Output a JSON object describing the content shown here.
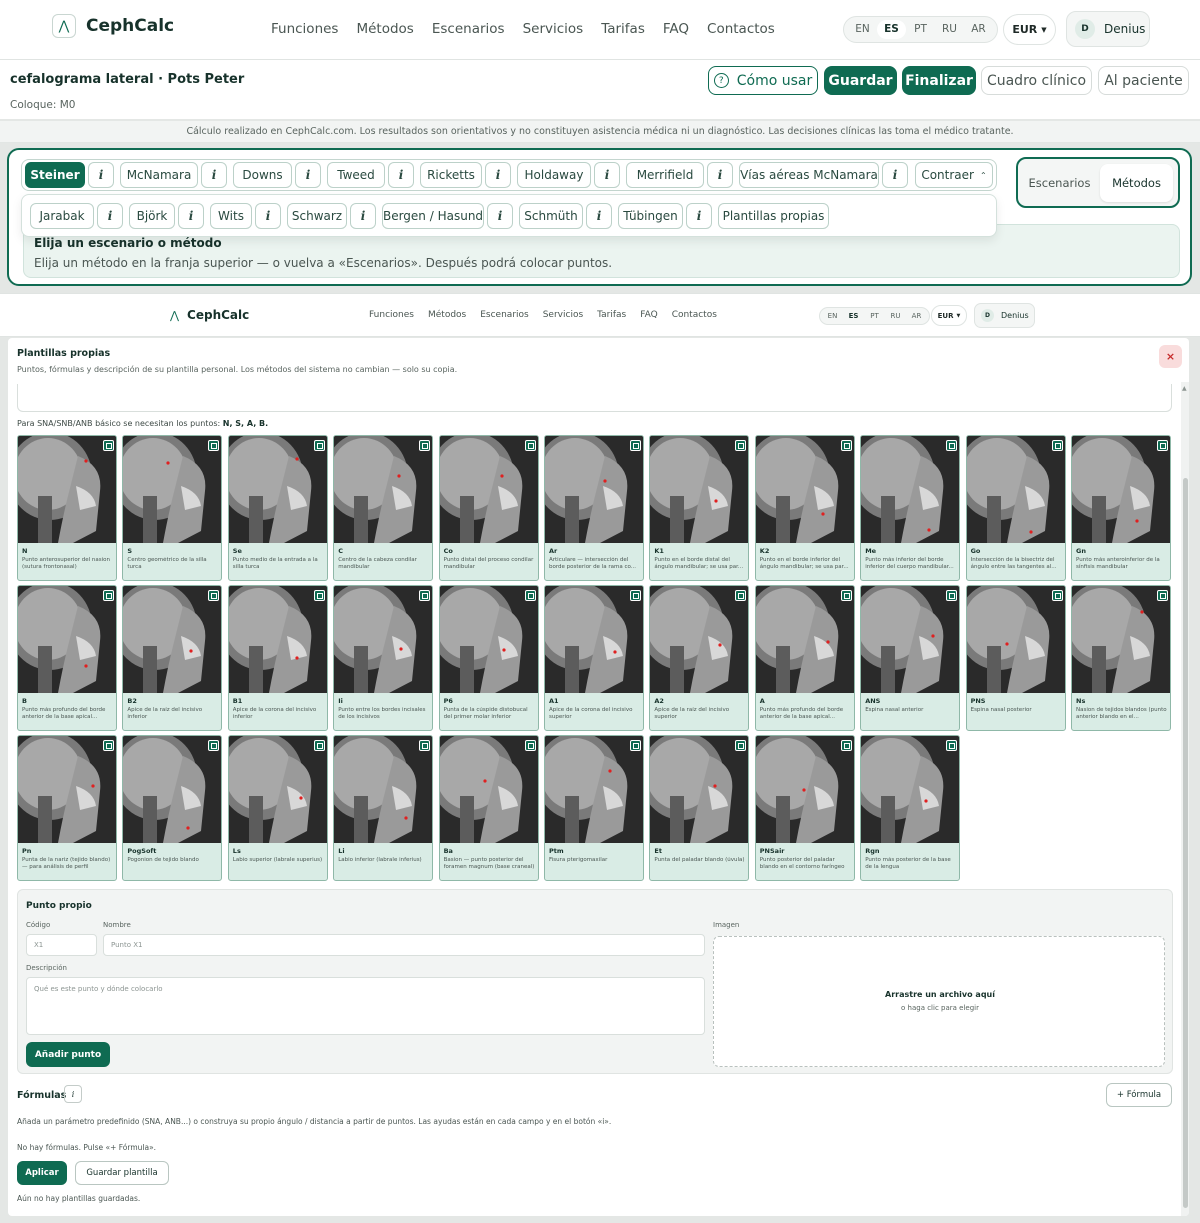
{
  "header": {
    "logo": "CephCalc",
    "nav": [
      "Funciones",
      "Métodos",
      "Escenarios",
      "Servicios",
      "Tarifas",
      "FAQ",
      "Contactos"
    ],
    "langs": [
      "EN",
      "ES",
      "PT",
      "RU",
      "AR"
    ],
    "active_lang": "ES",
    "currency": "EUR",
    "user_initial": "D",
    "user_name": "Denius"
  },
  "patient": {
    "title": "cefalograma lateral · Pots Peter",
    "sub": "Coloque: M0"
  },
  "actions": {
    "how": "Cómo usar",
    "save": "Guardar",
    "finish": "Finalizar",
    "clinical": "Cuadro clínico",
    "patient": "Al paciente"
  },
  "disclaimer": "Cálculo realizado en CephCalc.com. Los resultados son orientativos y no constituyen asistencia médica ni un diagnóstico. Las decisiones clínicas las toma el médico tratante.",
  "methods": {
    "row1": [
      "Steiner",
      "McNamara",
      "Downs",
      "Tweed",
      "Ricketts",
      "Holdaway",
      "Merrifield",
      "Vías aéreas McNamara"
    ],
    "row2": [
      "Jarabak",
      "Björk",
      "Wits",
      "Schwarz",
      "Bergen / Hasund",
      "Schmüth",
      "Tübingen"
    ],
    "own": "Plantillas propias",
    "collapse": "Contraer",
    "info": "i"
  },
  "hint": {
    "title": "Elija un escenario o método",
    "desc": "Elija un método en la franja superior — o vuelva a «Escenarios». Después podrá colocar puntos."
  },
  "switch": {
    "scenarios": "Escenarios",
    "methods": "Métodos"
  },
  "modal": {
    "title": "Plantillas propias",
    "sub": "Puntos, fórmulas y descripción de su plantilla personal. Los métodos del sistema no cambian — solo su copia.",
    "close": "×",
    "req_text": "Para SNA/SNB/ANB básico se necesitan los puntos:",
    "req_points": "N, S, A, B.",
    "points": [
      {
        "code": "N",
        "desc": "Punto anterosuperior del nasion (sutura frontonasal)"
      },
      {
        "code": "S",
        "desc": "Centro geométrico de la silla turca"
      },
      {
        "code": "Se",
        "desc": "Punto medio de la entrada a la silla turca"
      },
      {
        "code": "C",
        "desc": "Centro de la cabeza condilar mandibular"
      },
      {
        "code": "Co",
        "desc": "Punto distal del proceso condilar mandibular"
      },
      {
        "code": "Ar",
        "desc": "Articulare — intersección del borde posterior de la rama co..."
      },
      {
        "code": "K1",
        "desc": "Punto en el borde distal del ángulo mandibular; se usa par..."
      },
      {
        "code": "K2",
        "desc": "Punto en el borde inferior del ángulo mandibular; se usa par..."
      },
      {
        "code": "Me",
        "desc": "Punto más inferior del borde inferior del cuerpo mandibular..."
      },
      {
        "code": "Go",
        "desc": "Intersección de la bisectriz del ángulo entre las tangentes al..."
      },
      {
        "code": "Gn",
        "desc": "Punto más anteroinferior de la sínfisis mandibular"
      },
      {
        "code": "B",
        "desc": "Punto más profundo del borde anterior de la base apical..."
      },
      {
        "code": "B2",
        "desc": "Ápice de la raíz del incisivo inferior"
      },
      {
        "code": "B1",
        "desc": "Ápice de la corona del incisivo inferior"
      },
      {
        "code": "Ii",
        "desc": "Punto entre los bordes incisales de los incisivos"
      },
      {
        "code": "P6",
        "desc": "Punta de la cúspide distobucal del primer molar inferior"
      },
      {
        "code": "A1",
        "desc": "Ápice de la corona del incisivo superior"
      },
      {
        "code": "A2",
        "desc": "Ápice de la raíz del incisivo superior"
      },
      {
        "code": "A",
        "desc": "Punto más profundo del borde anterior de la base apical..."
      },
      {
        "code": "ANS",
        "desc": "Espina nasal anterior"
      },
      {
        "code": "PNS",
        "desc": "Espina nasal posterior"
      },
      {
        "code": "Ns",
        "desc": "Nasion de tejidos blandos (punto anterior blando en el..."
      },
      {
        "code": "Pn",
        "desc": "Punta de la nariz (tejido blando) — para análisis de perfil"
      },
      {
        "code": "PogSoft",
        "desc": "Pogonion de tejido blando"
      },
      {
        "code": "Ls",
        "desc": "Labio superior (labrale superius)"
      },
      {
        "code": "Li",
        "desc": "Labio inferior (labrale inferius)"
      },
      {
        "code": "Ba",
        "desc": "Basion — punto posterior del foramen magnum (base craneal)"
      },
      {
        "code": "Ptm",
        "desc": "Fisura pterigomaxilar"
      },
      {
        "code": "Et",
        "desc": "Punta del paladar blando (úvula)"
      },
      {
        "code": "PNSair",
        "desc": "Punto posterior del paladar blando en el contorno faríngeo"
      },
      {
        "code": "Rgn",
        "desc": "Punto más posterior de la base de la lengua"
      }
    ],
    "own_point": {
      "title": "Punto propio",
      "code_label": "Código",
      "code_ph": "X1",
      "name_label": "Nombre",
      "name_ph": "Punto X1",
      "desc_label": "Descripción",
      "desc_ph": "Qué es este punto y dónde colocarlo",
      "image_label": "Imagen",
      "drop_title": "Arrastre un archivo aquí",
      "drop_sub": "o haga clic para elegir",
      "add": "Añadir punto"
    },
    "formulas": {
      "title": "Fórmulas",
      "info": "i",
      "add": "+ Fórmula",
      "desc": "Añada un parámetro predefinido (SNA, ANB...) o construya su propio ángulo / distancia a partir de puntos. Las ayudas están en cada campo y en el botón «i».",
      "none": "No hay fórmulas. Pulse «+ Fórmula».",
      "apply": "Aplicar",
      "save_tpl": "Guardar plantilla",
      "no_tpl": "Aún no hay plantillas guardadas."
    }
  },
  "colors": {
    "accent": "#0f6b52",
    "card_bg": "#d9ece5",
    "marker": "#e02020"
  }
}
